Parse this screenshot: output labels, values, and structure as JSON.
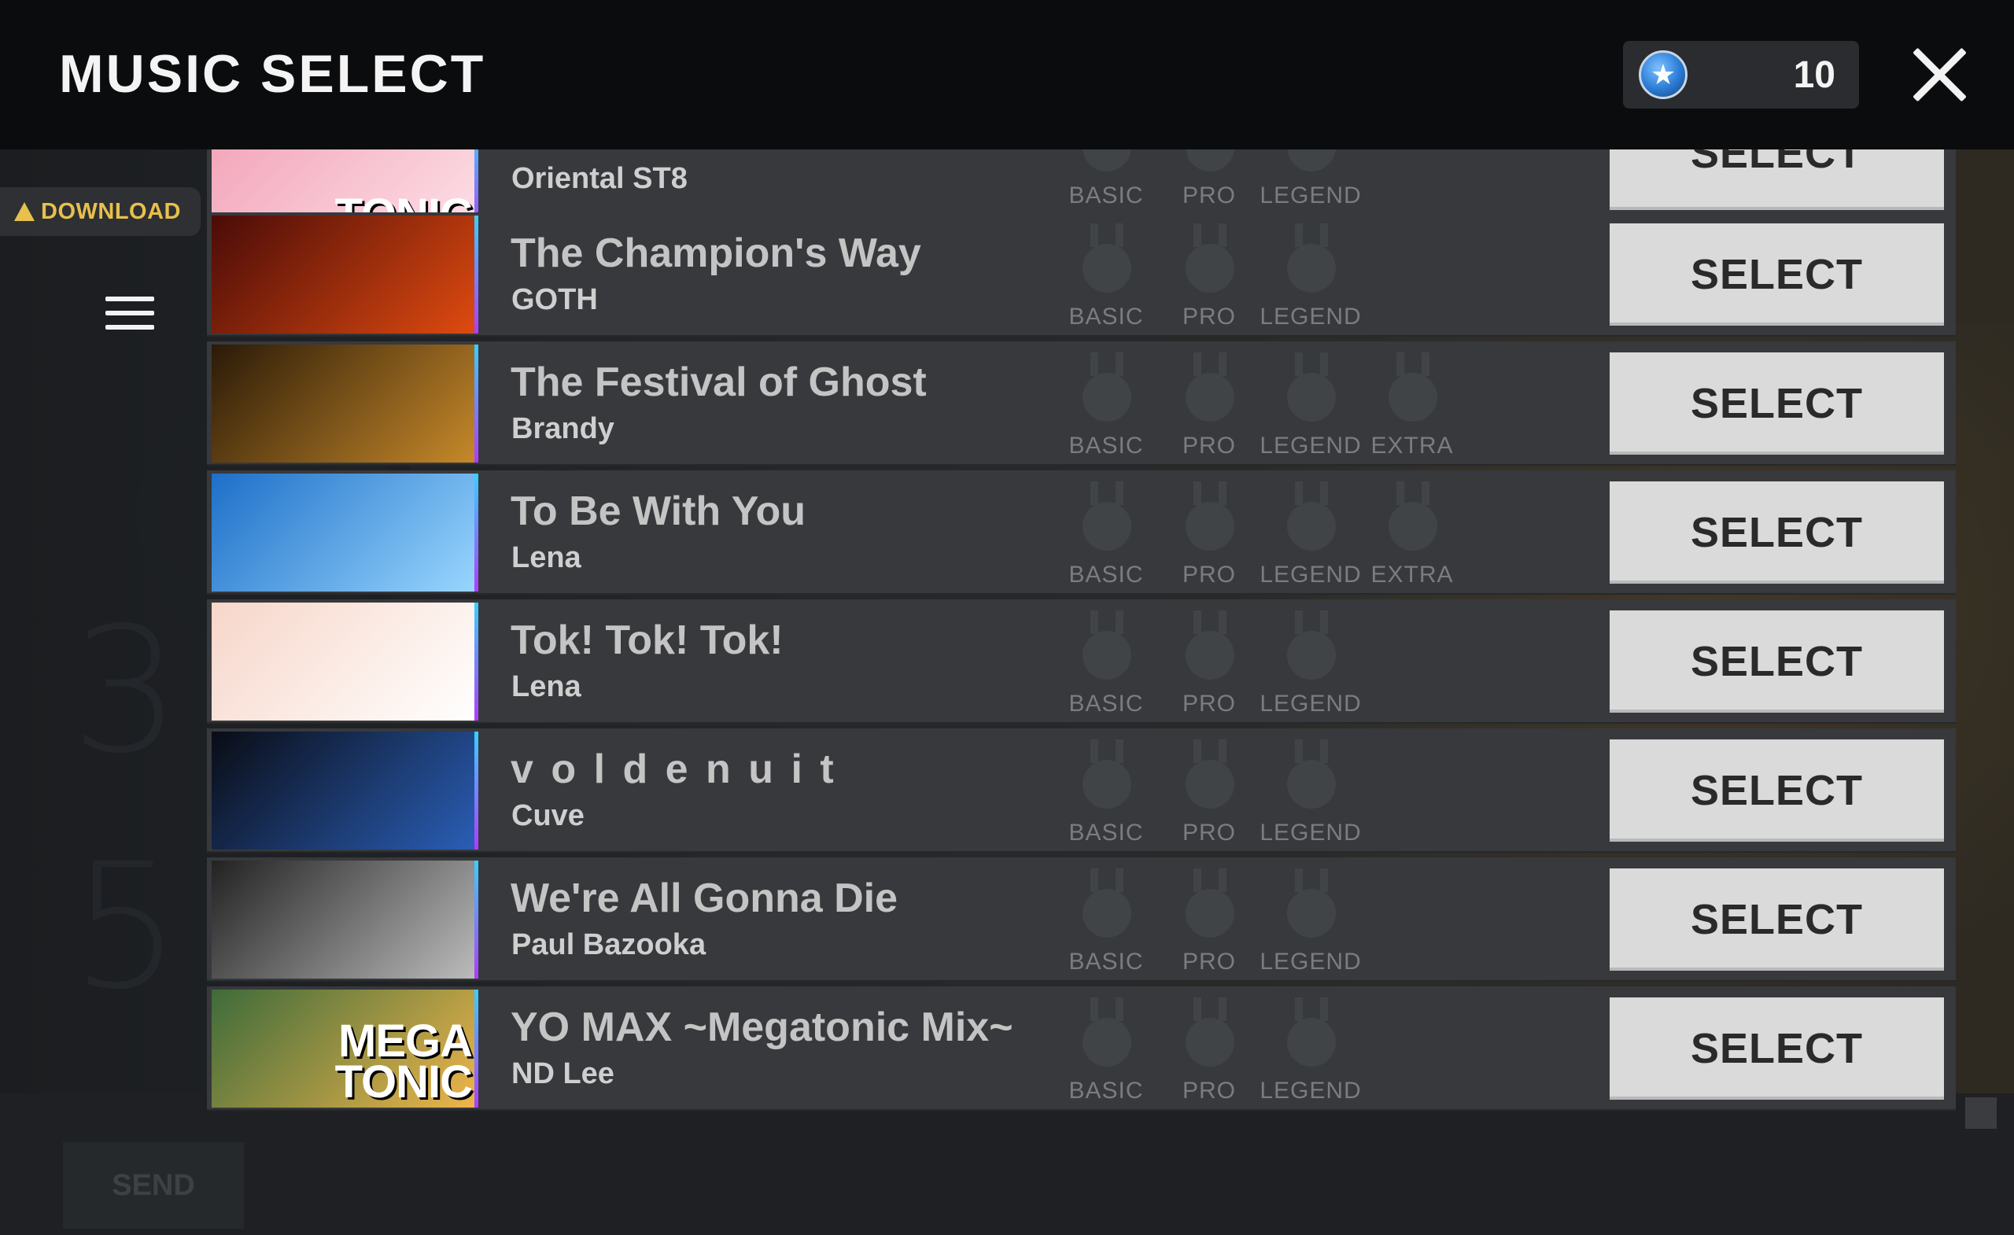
{
  "header": {
    "title": "MUSIC SELECT",
    "credits": "10"
  },
  "left": {
    "download_label": "DOWNLOAD"
  },
  "background": {
    "send_label": "SEND"
  },
  "difficulty_labels": {
    "basic": "BASIC",
    "pro": "PRO",
    "legend": "LEGEND",
    "extra": "EXTRA"
  },
  "select_label": "SELECT",
  "songs": [
    {
      "title": "",
      "artist": "Oriental ST8",
      "thumb_text": "TONIC",
      "extra": false,
      "thumb_bg": [
        "#f2a3b8",
        "#fde1e8"
      ]
    },
    {
      "title": "The Champion's Way",
      "artist": "GOTH",
      "thumb_text": "",
      "extra": false,
      "thumb_bg": [
        "#4a0b08",
        "#e04b10"
      ]
    },
    {
      "title": "The Festival of Ghost",
      "artist": "Brandy",
      "thumb_text": "",
      "extra": true,
      "thumb_bg": [
        "#2a1a08",
        "#c88a2a"
      ]
    },
    {
      "title": "To Be With You",
      "artist": "Lena",
      "thumb_text": "",
      "extra": true,
      "thumb_bg": [
        "#1d6fc8",
        "#9ad7ff"
      ]
    },
    {
      "title": "Tok! Tok! Tok!",
      "artist": "Lena",
      "thumb_text": "",
      "extra": false,
      "thumb_bg": [
        "#f7d6c9",
        "#ffffff"
      ]
    },
    {
      "title": "v o l d e n u i t",
      "artist": "Cuve",
      "thumb_text": "",
      "extra": false,
      "thumb_bg": [
        "#0a0c14",
        "#2a5fb8"
      ]
    },
    {
      "title": "We're All Gonna Die",
      "artist": "Paul Bazooka",
      "thumb_text": "",
      "extra": false,
      "thumb_bg": [
        "#222222",
        "#bdbdbd"
      ]
    },
    {
      "title": "YO MAX ~Megatonic Mix~",
      "artist": "ND Lee",
      "thumb_text": "MEGA TONIC",
      "extra": false,
      "thumb_bg": [
        "#3e6b3a",
        "#f0b64a"
      ]
    }
  ],
  "colors": {
    "accent_yellow": "#e7c04d",
    "select_bg": "#dadada",
    "row_bg": "#37393c"
  },
  "icons": {
    "credit": "star-coin-icon",
    "close": "close-icon",
    "menu": "hamburger-menu-icon",
    "download": "warning-triangle-icon"
  }
}
